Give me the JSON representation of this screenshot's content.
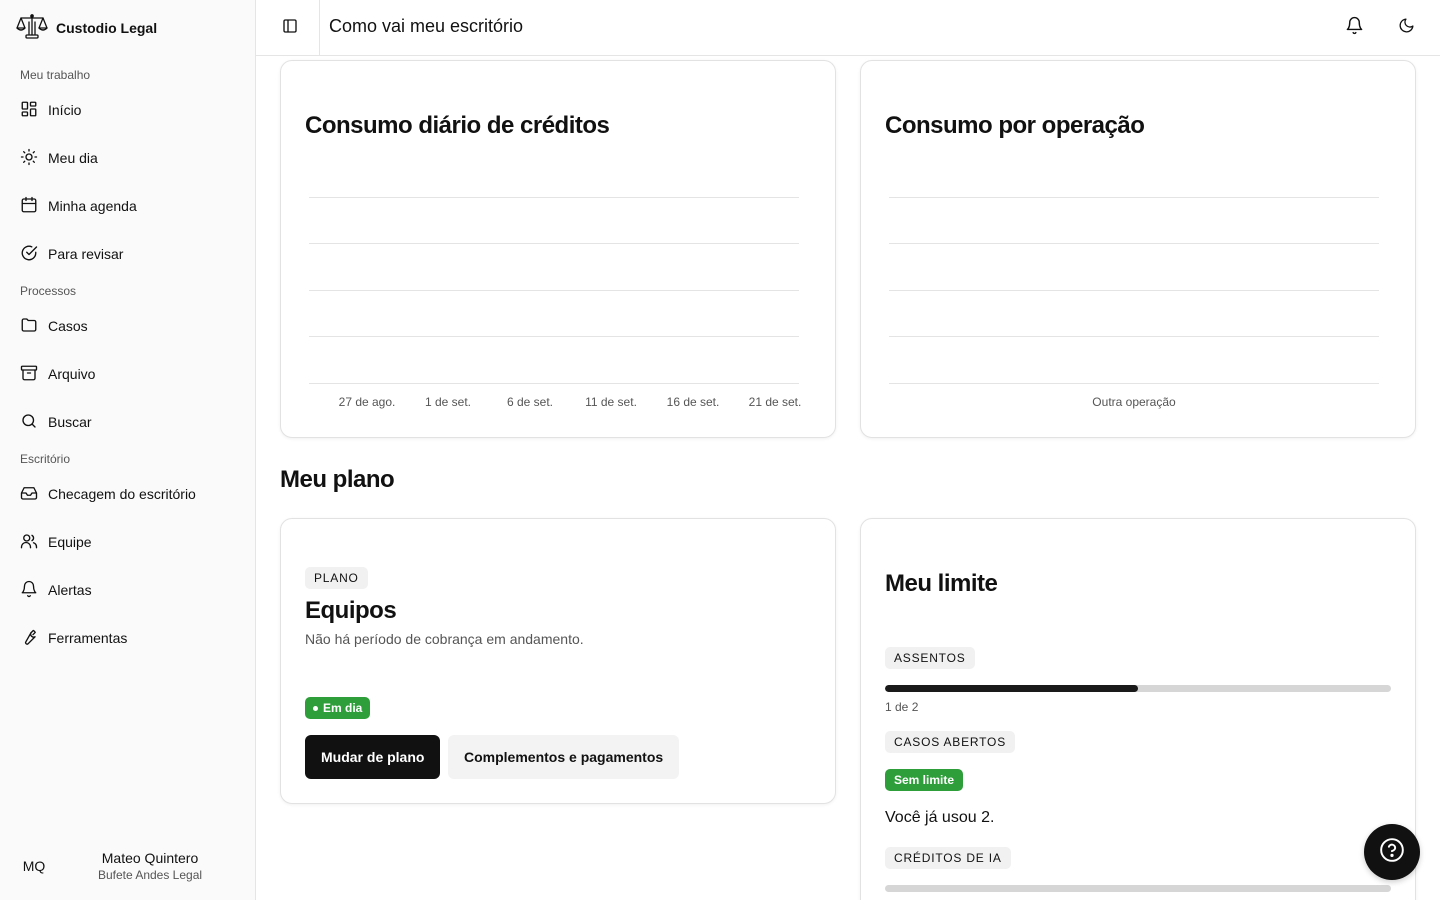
{
  "app": {
    "name": "Custodio Legal"
  },
  "sidebar": {
    "groups": [
      {
        "label": "Meu trabalho",
        "items": [
          {
            "label": "Início",
            "icon": "layout-grid-icon"
          },
          {
            "label": "Meu dia",
            "icon": "sun-icon"
          },
          {
            "label": "Minha agenda",
            "icon": "calendar-icon"
          },
          {
            "label": "Para revisar",
            "icon": "check-circle-icon"
          }
        ]
      },
      {
        "label": "Processos",
        "items": [
          {
            "label": "Casos",
            "icon": "folder-icon"
          },
          {
            "label": "Arquivo",
            "icon": "archive-icon"
          },
          {
            "label": "Buscar",
            "icon": "search-icon"
          }
        ]
      },
      {
        "label": "Escritório",
        "items": [
          {
            "label": "Checagem do escritório",
            "icon": "inbox-icon"
          },
          {
            "label": "Equipe",
            "icon": "users-icon"
          },
          {
            "label": "Alertas",
            "icon": "bell-icon"
          },
          {
            "label": "Ferramentas",
            "icon": "wrench-icon"
          }
        ]
      }
    ],
    "user": {
      "initials": "MQ",
      "name": "Mateo Quintero",
      "org": "Bufete Andes Legal"
    }
  },
  "header": {
    "title": "Como vai meu escritório"
  },
  "charts": {
    "daily": {
      "title": "Consumo diário de créditos",
      "x_ticks": [
        "27 de ago.",
        "1 de set.",
        "6 de set.",
        "11 de set.",
        "16 de set.",
        "21 de set."
      ]
    },
    "operation": {
      "title": "Consumo por operação",
      "x_ticks": [
        "Outra operação"
      ]
    }
  },
  "chart_data": [
    {
      "type": "line",
      "title": "Consumo diário de créditos",
      "x": [
        "27 de ago.",
        "1 de set.",
        "6 de set.",
        "11 de set.",
        "16 de set.",
        "21 de set."
      ],
      "series": [],
      "grid": true
    },
    {
      "type": "bar",
      "title": "Consumo por operação",
      "categories": [
        "Outra operação"
      ],
      "series": [],
      "grid": true
    }
  ],
  "plan_section": {
    "title": "Meu plano",
    "plan": {
      "tag": "PLANO",
      "name": "Equipos",
      "description": "Não há período de cobrança em andamento.",
      "status": "Em dia",
      "change_button": "Mudar de plano",
      "addons_button": "Complementos e pagamentos"
    },
    "limits": {
      "title": "Meu limite",
      "seats": {
        "tag": "ASSENTOS",
        "used": 1,
        "total": 2,
        "text": "1 de 2",
        "fraction": 0.5
      },
      "open_cases": {
        "tag": "CASOS ABERTOS",
        "badge": "Sem limite",
        "used_text": "Você já usou 2."
      },
      "ai_credits": {
        "tag": "CRÉDITOS DE IA",
        "fraction": 0
      }
    }
  },
  "colors": {
    "accent": "#111111",
    "success": "#2e9e3a",
    "track": "#d6d6d6"
  }
}
